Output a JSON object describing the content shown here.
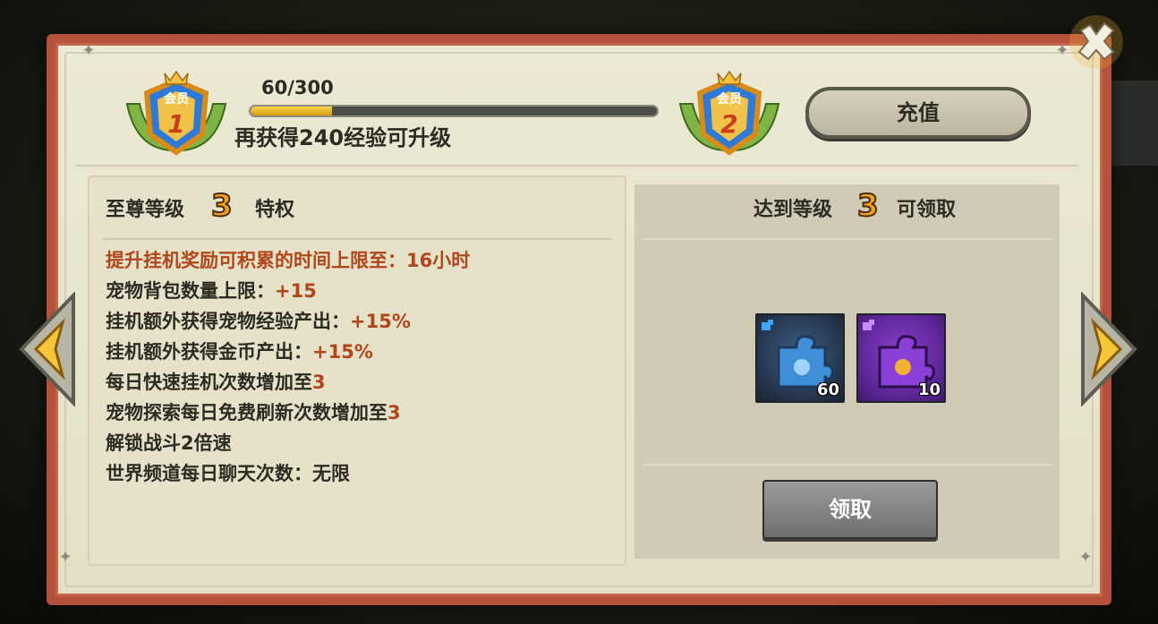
{
  "header": {
    "current_badge": {
      "label": "会员",
      "level": "1"
    },
    "next_badge": {
      "label": "会员",
      "level": "2"
    },
    "progress_value": "60/300",
    "progress_fraction": 0.2,
    "progress_hint": "再获得240经验可升级",
    "recharge_label": "充值"
  },
  "privileges": {
    "title_prefix": "至尊等级",
    "level": "3",
    "title_suffix": "特权",
    "items": [
      {
        "text": "提升挂机奖励可积累的时间上限至：16小时"
      },
      {
        "text": "宠物背包数量上限：",
        "value": "+15"
      },
      {
        "text": "挂机额外获得宠物经验产出：",
        "value": "+15%"
      },
      {
        "text": "挂机额外获得金币产出：",
        "value": "+15%"
      },
      {
        "text": "每日快速挂机次数增加至",
        "value": "3"
      },
      {
        "text": "宠物探索每日免费刷新次数增加至",
        "value": "3"
      },
      {
        "text": "解锁战斗2倍速"
      },
      {
        "text": "世界频道每日聊天次数：无限"
      }
    ]
  },
  "rewards": {
    "title_prefix": "达到等级",
    "level": "3",
    "title_suffix": "可领取",
    "items": [
      {
        "icon": "blue-puzzle-piece-icon",
        "count": "60",
        "color": "#2f4a6b"
      },
      {
        "icon": "purple-puzzle-piece-icon",
        "count": "10",
        "color": "#6a2aa8"
      }
    ],
    "claim_label": "领取"
  },
  "colors": {
    "frame_red": "#b5503a",
    "parchment": "#e8e4cc",
    "highlight_text": "#b2461b",
    "level_gold": "#f4a21e"
  }
}
